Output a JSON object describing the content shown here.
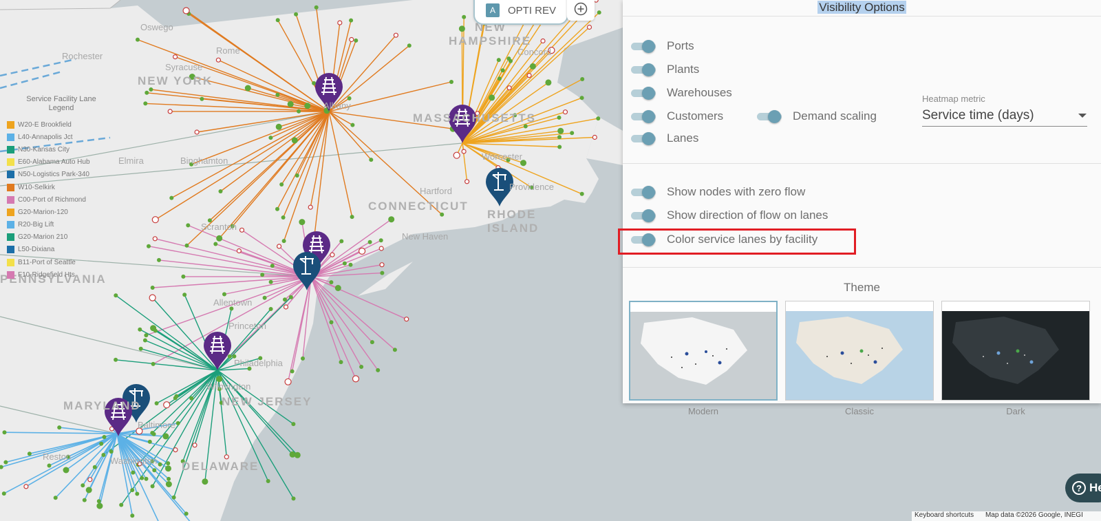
{
  "map": {
    "state_labels": [
      "NEW YORK",
      "MASSACHUSETTS",
      "CONNECTICUT",
      "RHODE",
      "ISLAND",
      "NEW",
      "HAMPSHIRE",
      "PENNSYLVANIA",
      "NEW JERSEY",
      "DELAWARE",
      "MARYLAND"
    ],
    "city_labels": [
      "Oswego",
      "Rochester",
      "Syracuse",
      "Rome",
      "Elmira",
      "Binghamton",
      "Scranton",
      "Allentown",
      "Princeton",
      "Philadelphia",
      "Hartford",
      "Providence",
      "Concord",
      "Albany",
      "Baltimore",
      "Washington",
      "Reston",
      "Wilmington",
      "New Haven",
      "Worcester"
    ],
    "colors": {
      "water": "#c5cdd1",
      "land": "#ececec",
      "orange": "#e07a1f",
      "gold": "#eea41f",
      "pink": "#d57ab1",
      "teal": "#1b9e7a",
      "blue": "#5cb1e6",
      "purple_pin": "#5b2a86",
      "navy_pin": "#1a4f7a",
      "customer": "#5fa83a",
      "warehouse": "#c63b3b"
    }
  },
  "legend": {
    "title_line1": "Service Facility Lane",
    "title_line2": "Legend",
    "items": [
      {
        "label": "W20-E Brookfield",
        "color": "#eea41f"
      },
      {
        "label": "L40-Annapolis Jct",
        "color": "#5cb1e6"
      },
      {
        "label": "N30-Kansas City",
        "color": "#1b9e7a"
      },
      {
        "label": "E60-Alabama Auto Hub",
        "color": "#f3e04a"
      },
      {
        "label": "N50-Logistics Park-340",
        "color": "#1c6fa8"
      },
      {
        "label": "W10-Selkirk",
        "color": "#e07a1f"
      },
      {
        "label": "C00-Port of Richmond",
        "color": "#d57ab1"
      },
      {
        "label": "G20-Marion-120",
        "color": "#eea41f"
      },
      {
        "label": "R20-Big Lift",
        "color": "#5cb1e6"
      },
      {
        "label": "G20-Marion 210",
        "color": "#1b9e7a"
      },
      {
        "label": "L50-Dixiana",
        "color": "#1c6fa8"
      },
      {
        "label": "B11-Port of Seattle",
        "color": "#f3e04a"
      },
      {
        "label": "F10-Ridgefield Hts",
        "color": "#d57ab1"
      }
    ]
  },
  "scenario": {
    "badge": "A",
    "name": "OPTI REV",
    "add_icon": "plus-circle-icon"
  },
  "panel": {
    "title": "Visibility Options",
    "toggles": [
      {
        "label": "Ports",
        "on": true
      },
      {
        "label": "Plants",
        "on": true
      },
      {
        "label": "Warehouses",
        "on": true
      },
      {
        "label": "Customers",
        "on": true
      },
      {
        "label": "Demand scaling",
        "on": true
      },
      {
        "label": "Lanes",
        "on": true
      },
      {
        "label": "Show nodes with zero flow",
        "on": true
      },
      {
        "label": "Show direction of flow on lanes",
        "on": true
      },
      {
        "label": "Color service lanes by facility",
        "on": true
      }
    ],
    "heatmap_label": "Heatmap metric",
    "heatmap_value": "Service time (days)",
    "theme_title": "Theme",
    "themes": [
      {
        "label": "Modern",
        "selected": true
      },
      {
        "label": "Classic",
        "selected": false
      },
      {
        "label": "Dark",
        "selected": false
      }
    ]
  },
  "help_label": "He",
  "attribution": {
    "shortcuts": "Keyboard shortcuts",
    "mapdata": "Map data ©2026 Google, INEGI"
  }
}
